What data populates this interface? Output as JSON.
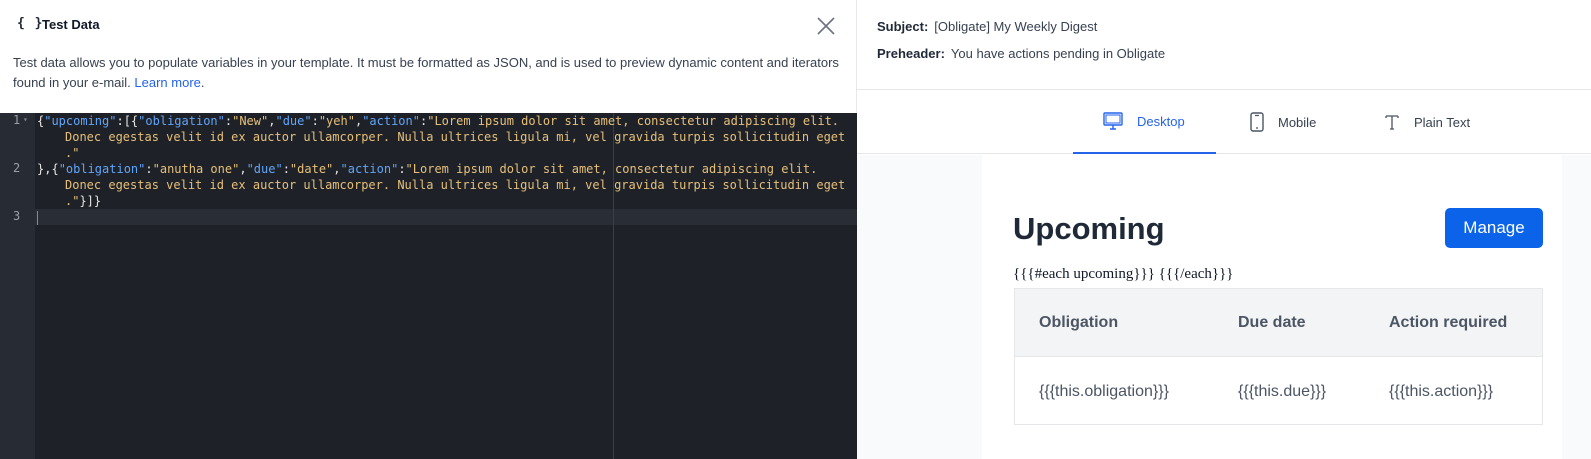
{
  "test_data_panel": {
    "braces_icon": "{ }",
    "title": "Test Data",
    "description": "Test data allows you to populate variables in your template. It must be formatted as JSON, and is used to preview dynamic content and iterators found in your e-mail.",
    "learn_more": "Learn more",
    "close_icon": "close-icon"
  },
  "editor": {
    "line_numbers": [
      "1",
      "2",
      "3"
    ],
    "line1": {
      "p1": "{",
      "k_upcoming": "\"upcoming\"",
      "p2": ":[{",
      "k_obligation": "\"obligation\"",
      "p3": ":",
      "s_new": "\"New\"",
      "p4": ",",
      "k_due": "\"due\"",
      "p5": ":",
      "s_yeh": "\"yeh\"",
      "p6": ",",
      "k_action": "\"action\"",
      "p7": ":",
      "s_a": "\"Lorem ipsum dolor sit amet, consectetur adipiscing elit.",
      "s_b": "Donec egestas velit id ex auctor ullamcorper. Nulla ultrices ligula mi, vel gravida turpis sollicitudin eget",
      "s_c": ".\""
    },
    "line2": {
      "p1": "},{",
      "k_obligation": "\"obligation\"",
      "p2": ":",
      "s_anutha": "\"anutha one\"",
      "p3": ",",
      "k_due": "\"due\"",
      "p4": ":",
      "s_date": "\"date\"",
      "p5": ",",
      "k_action": "\"action\"",
      "p6": ":",
      "s_a": "\"Lorem ipsum dolor sit amet, consectetur adipiscing elit.",
      "s_b": "Donec egestas velit id ex auctor ullamcorper. Nulla ultrices ligula mi, vel gravida turpis sollicitudin eget",
      "s_c": ".\"",
      "p_end": "}]}"
    }
  },
  "meta": {
    "subject_label": "Subject:",
    "subject_value": "[Obligate] My Weekly Digest",
    "preheader_label": "Preheader:",
    "preheader_value": "You have actions pending in Obligate"
  },
  "tabs": [
    {
      "label": "Desktop",
      "icon": "monitor-icon",
      "active": true
    },
    {
      "label": "Mobile",
      "icon": "phone-icon",
      "active": false
    },
    {
      "label": "Plain Text",
      "icon": "text-icon",
      "active": false
    }
  ],
  "email": {
    "title": "Upcoming",
    "manage_label": "Manage",
    "handlebars": "{{{#each upcoming}}} {{{/each}}}",
    "table": {
      "headers": [
        "Obligation",
        "Due date",
        "Action required"
      ],
      "row": [
        "{{{this.obligation}}}",
        "{{{this.due}}}",
        "{{{this.action}}}"
      ]
    }
  },
  "colors": {
    "accent": "#2563eb",
    "button": "#0a63e9",
    "editor_bg": "#1e2127",
    "json_key": "#60a5fa",
    "json_string": "#e6c07b"
  }
}
